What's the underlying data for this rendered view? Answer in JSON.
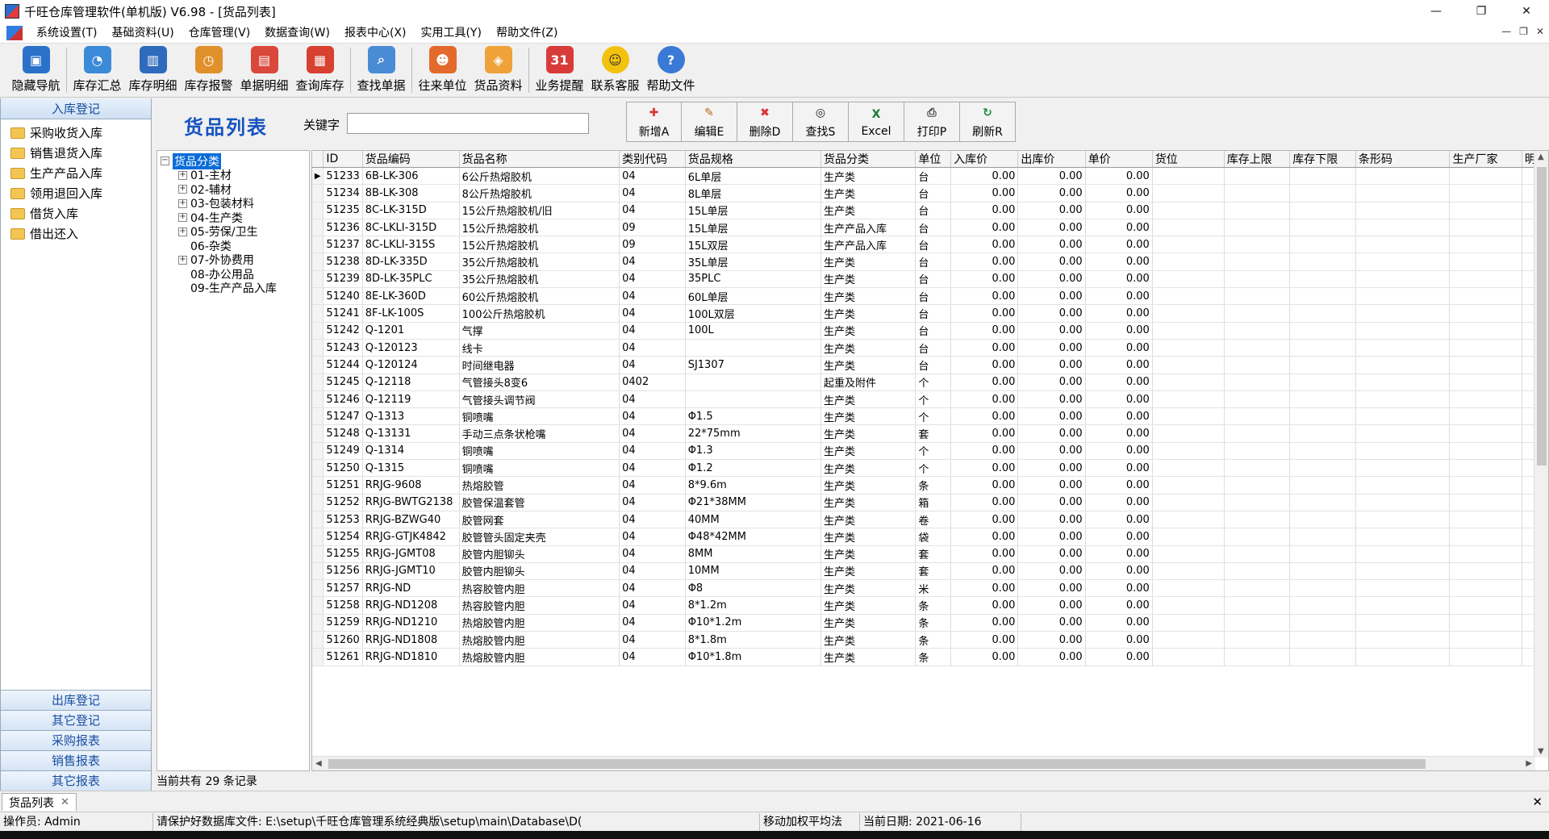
{
  "window": {
    "title": "千旺仓库管理软件(单机版) V6.98 - [货品列表]",
    "controls": [
      "—",
      "❐",
      "✕"
    ]
  },
  "menubar": {
    "items": [
      "系统设置(T)",
      "基础资料(U)",
      "仓库管理(V)",
      "数据查询(W)",
      "报表中心(X)",
      "实用工具(Y)",
      "帮助文件(Z)"
    ],
    "mdi_controls": [
      "—",
      "❐",
      "✕"
    ]
  },
  "toolbar": {
    "buttons": [
      {
        "label": "隐藏导航",
        "icon": "monitor-icon",
        "color": "#2a72c9",
        "glyph": "▣"
      },
      {
        "label": "库存汇总",
        "icon": "pie-chart-icon",
        "color": "#3b8ad8",
        "glyph": "◔"
      },
      {
        "label": "库存明细",
        "icon": "bar-chart-icon",
        "color": "#2e6bbd",
        "glyph": "▥"
      },
      {
        "label": "库存报警",
        "icon": "gauge-icon",
        "color": "#e0912b",
        "glyph": "◷"
      },
      {
        "label": "单据明细",
        "icon": "documents-icon",
        "color": "#d9483b",
        "glyph": "▤"
      },
      {
        "label": "查询库存",
        "icon": "boxes-icon",
        "color": "#d8402f",
        "glyph": "▦"
      },
      {
        "label": "查找单据",
        "icon": "magnifier-doc-icon",
        "color": "#4a8bd6",
        "glyph": "⌕"
      },
      {
        "label": "往来单位",
        "icon": "people-icon",
        "color": "#e36a2b",
        "glyph": "☻"
      },
      {
        "label": "货品资料",
        "icon": "package-icon",
        "color": "#f0a23a",
        "glyph": "◈"
      },
      {
        "label": "业务提醒",
        "icon": "calendar-icon",
        "color": "#d93b3b",
        "glyph": "31"
      },
      {
        "label": "联系客服",
        "icon": "smiley-icon",
        "color": "#f2c20f",
        "glyph": "☺"
      },
      {
        "label": "帮助文件",
        "icon": "help-icon",
        "color": "#3a79d6",
        "glyph": "?"
      }
    ]
  },
  "leftnav": {
    "header": "入库登记",
    "items": [
      "采购收货入库",
      "销售退货入库",
      "生产产品入库",
      "领用退回入库",
      "借货入库",
      "借出还入"
    ],
    "categories": [
      "出库登记",
      "其它登记",
      "采购报表",
      "销售报表",
      "其它报表"
    ]
  },
  "main": {
    "title": "货品列表",
    "keyword_label": "关键字",
    "keyword_value": "",
    "actions": [
      {
        "label": "新增A",
        "icon": "add-icon",
        "glyph": "✚",
        "color": "#d33"
      },
      {
        "label": "编辑E",
        "icon": "edit-icon",
        "glyph": "✎",
        "color": "#b56a18"
      },
      {
        "label": "删除D",
        "icon": "delete-icon",
        "glyph": "✖",
        "color": "#d33"
      },
      {
        "label": "查找S",
        "icon": "binoculars-icon",
        "glyph": "◎",
        "color": "#222"
      },
      {
        "label": "Excel",
        "icon": "excel-icon",
        "glyph": "X",
        "color": "#1d7a36"
      },
      {
        "label": "打印P",
        "icon": "print-icon",
        "glyph": "⎙",
        "color": "#444"
      },
      {
        "label": "刷新R",
        "icon": "refresh-icon",
        "glyph": "↻",
        "color": "#1d8a3a"
      }
    ],
    "record_count": "当前共有 29 条记录"
  },
  "tree": {
    "root": "货品分类",
    "nodes": [
      {
        "label": "01-主材",
        "expandable": true
      },
      {
        "label": "02-辅材",
        "expandable": true
      },
      {
        "label": "03-包装材料",
        "expandable": true
      },
      {
        "label": "04-生产类",
        "expandable": true
      },
      {
        "label": "05-劳保/卫生",
        "expandable": true
      },
      {
        "label": "06-杂类",
        "expandable": false
      },
      {
        "label": "07-外协费用",
        "expandable": true
      },
      {
        "label": "08-办公用品",
        "expandable": false
      },
      {
        "label": "09-生产产品入库",
        "expandable": false
      }
    ]
  },
  "grid": {
    "columns": [
      "ID",
      "货品编码",
      "货品名称",
      "类别代码",
      "货品规格",
      "货品分类",
      "单位",
      "入库价",
      "出库价",
      "单价",
      "货位",
      "库存上限",
      "库存下限",
      "条形码",
      "生产厂家",
      "明细"
    ],
    "rows": [
      [
        "51233",
        "6B-LK-306",
        "6公斤热熔胶机",
        "04",
        "6L单层",
        "生产类",
        "台",
        "0.00",
        "0.00",
        "0.00"
      ],
      [
        "51234",
        "8B-LK-308",
        "8公斤热熔胶机",
        "04",
        "8L单层",
        "生产类",
        "台",
        "0.00",
        "0.00",
        "0.00"
      ],
      [
        "51235",
        "8C-LK-315D",
        "15公斤热熔胶机/旧",
        "04",
        "15L单层",
        "生产类",
        "台",
        "0.00",
        "0.00",
        "0.00"
      ],
      [
        "51236",
        "8C-LKLI-315D",
        "15公斤热熔胶机",
        "09",
        "15L单层",
        "生产产品入库",
        "台",
        "0.00",
        "0.00",
        "0.00"
      ],
      [
        "51237",
        "8C-LKLI-315S",
        "15公斤热熔胶机",
        "09",
        "15L双层",
        "生产产品入库",
        "台",
        "0.00",
        "0.00",
        "0.00"
      ],
      [
        "51238",
        "8D-LK-335D",
        "35公斤热熔胶机",
        "04",
        "35L单层",
        "生产类",
        "台",
        "0.00",
        "0.00",
        "0.00"
      ],
      [
        "51239",
        "8D-LK-35PLC",
        "35公斤热熔胶机",
        "04",
        "35PLC",
        "生产类",
        "台",
        "0.00",
        "0.00",
        "0.00"
      ],
      [
        "51240",
        "8E-LK-360D",
        "60公斤热熔胶机",
        "04",
        "60L单层",
        "生产类",
        "台",
        "0.00",
        "0.00",
        "0.00"
      ],
      [
        "51241",
        "8F-LK-100S",
        "100公斤热熔胶机",
        "04",
        "100L双层",
        "生产类",
        "台",
        "0.00",
        "0.00",
        "0.00"
      ],
      [
        "51242",
        "Q-1201",
        "气撑",
        "04",
        "100L",
        "生产类",
        "台",
        "0.00",
        "0.00",
        "0.00"
      ],
      [
        "51243",
        "Q-120123",
        "线卡",
        "04",
        "",
        "生产类",
        "台",
        "0.00",
        "0.00",
        "0.00"
      ],
      [
        "51244",
        "Q-120124",
        "时间继电器",
        "04",
        "SJ1307",
        "生产类",
        "台",
        "0.00",
        "0.00",
        "0.00"
      ],
      [
        "51245",
        "Q-12118",
        "气管接头8变6",
        "0402",
        "",
        "起重及附件",
        "个",
        "0.00",
        "0.00",
        "0.00"
      ],
      [
        "51246",
        "Q-12119",
        "气管接头调节阀",
        "04",
        "",
        "生产类",
        "个",
        "0.00",
        "0.00",
        "0.00"
      ],
      [
        "51247",
        "Q-1313",
        "铜喷嘴",
        "04",
        "Φ1.5",
        "生产类",
        "个",
        "0.00",
        "0.00",
        "0.00"
      ],
      [
        "51248",
        "Q-13131",
        "手动三点条状枪嘴",
        "04",
        "22*75mm",
        "生产类",
        "套",
        "0.00",
        "0.00",
        "0.00"
      ],
      [
        "51249",
        "Q-1314",
        "铜喷嘴",
        "04",
        "Φ1.3",
        "生产类",
        "个",
        "0.00",
        "0.00",
        "0.00"
      ],
      [
        "51250",
        "Q-1315",
        "铜喷嘴",
        "04",
        "Φ1.2",
        "生产类",
        "个",
        "0.00",
        "0.00",
        "0.00"
      ],
      [
        "51251",
        "RRJG-9608",
        "热熔胶管",
        "04",
        "8*9.6m",
        "生产类",
        "条",
        "0.00",
        "0.00",
        "0.00"
      ],
      [
        "51252",
        "RRJG-BWTG2138",
        "胶管保温套管",
        "04",
        "Φ21*38MM",
        "生产类",
        "箱",
        "0.00",
        "0.00",
        "0.00"
      ],
      [
        "51253",
        "RRJG-BZWG40",
        "胶管网套",
        "04",
        "40MM",
        "生产类",
        "卷",
        "0.00",
        "0.00",
        "0.00"
      ],
      [
        "51254",
        "RRJG-GTJK4842",
        "胶管管头固定夹壳",
        "04",
        "Φ48*42MM",
        "生产类",
        "袋",
        "0.00",
        "0.00",
        "0.00"
      ],
      [
        "51255",
        "RRJG-JGMT08",
        "胶管内胆铆头",
        "04",
        "8MM",
        "生产类",
        "套",
        "0.00",
        "0.00",
        "0.00"
      ],
      [
        "51256",
        "RRJG-JGMT10",
        "胶管内胆铆头",
        "04",
        "10MM",
        "生产类",
        "套",
        "0.00",
        "0.00",
        "0.00"
      ],
      [
        "51257",
        "RRJG-ND",
        "热容胶管内胆",
        "04",
        "Φ8",
        "生产类",
        "米",
        "0.00",
        "0.00",
        "0.00"
      ],
      [
        "51258",
        "RRJG-ND1208",
        "热容胶管内胆",
        "04",
        "8*1.2m",
        "生产类",
        "条",
        "0.00",
        "0.00",
        "0.00"
      ],
      [
        "51259",
        "RRJG-ND1210",
        "热熔胶管内胆",
        "04",
        "Φ10*1.2m",
        "生产类",
        "条",
        "0.00",
        "0.00",
        "0.00"
      ],
      [
        "51260",
        "RRJG-ND1808",
        "热熔胶管内胆",
        "04",
        "8*1.8m",
        "生产类",
        "条",
        "0.00",
        "0.00",
        "0.00"
      ],
      [
        "51261",
        "RRJG-ND1810",
        "热熔胶管内胆",
        "04",
        "Φ10*1.8m",
        "生产类",
        "条",
        "0.00",
        "0.00",
        "0.00"
      ]
    ]
  },
  "tabs": {
    "active": "货品列表",
    "close": "✕",
    "strip_close": "✕"
  },
  "statusbar": {
    "operator": "操作员: Admin",
    "message": "请保护好数据库文件: E:\\setup\\千旺仓库管理系统经典版\\setup\\main\\Database\\D(",
    "method": "移动加权平均法",
    "date": "当前日期: 2021-06-16"
  }
}
